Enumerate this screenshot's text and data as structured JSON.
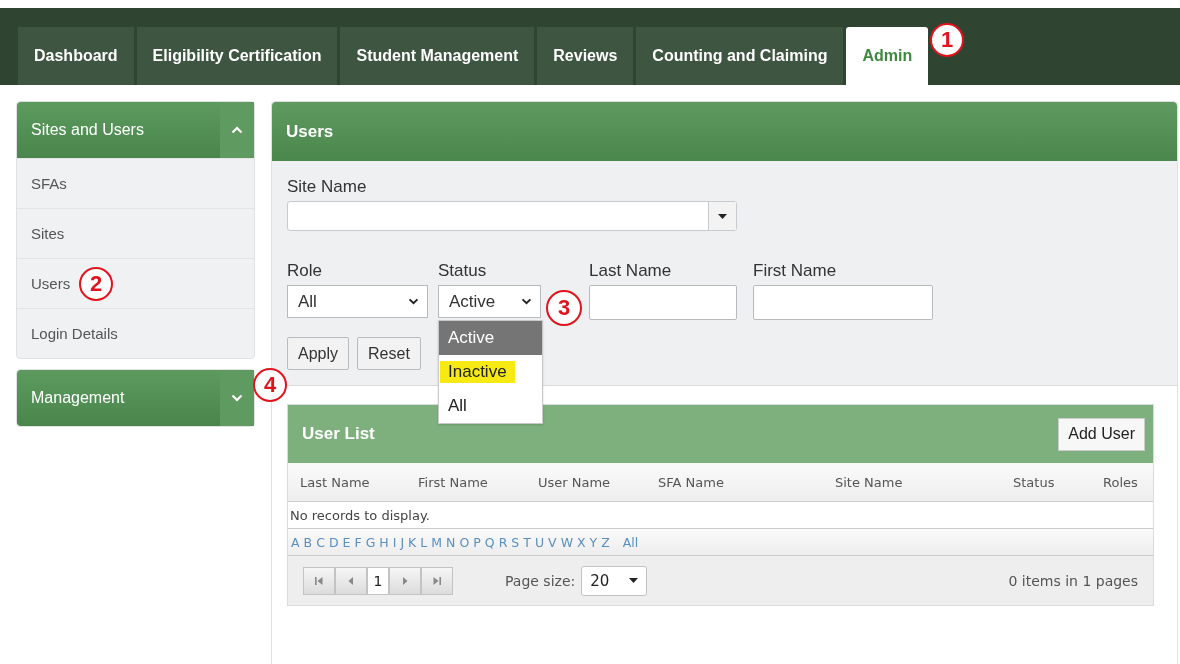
{
  "top_tabs": {
    "callout": "1",
    "items": [
      {
        "label": "Dashboard",
        "selected": false
      },
      {
        "label": "Eligibility Certification",
        "selected": false
      },
      {
        "label": "Student Management",
        "selected": false
      },
      {
        "label": "Reviews",
        "selected": false
      },
      {
        "label": "Counting and Claiming",
        "selected": false
      },
      {
        "label": "Admin",
        "selected": true
      }
    ]
  },
  "sidebar": {
    "sections": [
      {
        "title": "Sites and Users",
        "expanded": true,
        "items": [
          {
            "label": "SFAs"
          },
          {
            "label": "Sites"
          },
          {
            "label": "Users",
            "callout": "2"
          },
          {
            "label": "Login Details"
          }
        ]
      },
      {
        "title": "Management",
        "expanded": false,
        "callout": "4"
      }
    ]
  },
  "users_panel": {
    "title": "Users",
    "site_name": {
      "label": "Site Name"
    },
    "filters": [
      {
        "kind": "select",
        "label": "Role",
        "value": "All"
      },
      {
        "kind": "select",
        "label": "Status",
        "value": "Active",
        "expanded": true,
        "callout": "3",
        "options": [
          {
            "label": "Active",
            "selected": true,
            "highlighted": false
          },
          {
            "label": "Inactive",
            "selected": false,
            "highlighted": true
          },
          {
            "label": "All",
            "selected": false,
            "highlighted": false
          }
        ]
      },
      {
        "kind": "text",
        "label": "Last Name"
      },
      {
        "kind": "text",
        "label": "First Name"
      }
    ],
    "buttons": [
      "Apply",
      "Reset"
    ]
  },
  "user_list": {
    "title": "User List",
    "add_button": "Add User",
    "columns": [
      "Last Name",
      "First Name",
      "User Name",
      "SFA Name",
      "Site Name",
      "Status",
      "Roles"
    ],
    "empty_message": "No records to display.",
    "alphabet": [
      "A",
      "B",
      "C",
      "D",
      "E",
      "F",
      "G",
      "H",
      "I",
      "J",
      "K",
      "L",
      "M",
      "N",
      "O",
      "P",
      "Q",
      "R",
      "S",
      "T",
      "U",
      "V",
      "W",
      "X",
      "Y",
      "Z",
      "All"
    ],
    "pager": {
      "current_page": "1",
      "page_size_label": "Page size:",
      "page_size": "20",
      "summary": "0 items in 1 pages"
    }
  }
}
